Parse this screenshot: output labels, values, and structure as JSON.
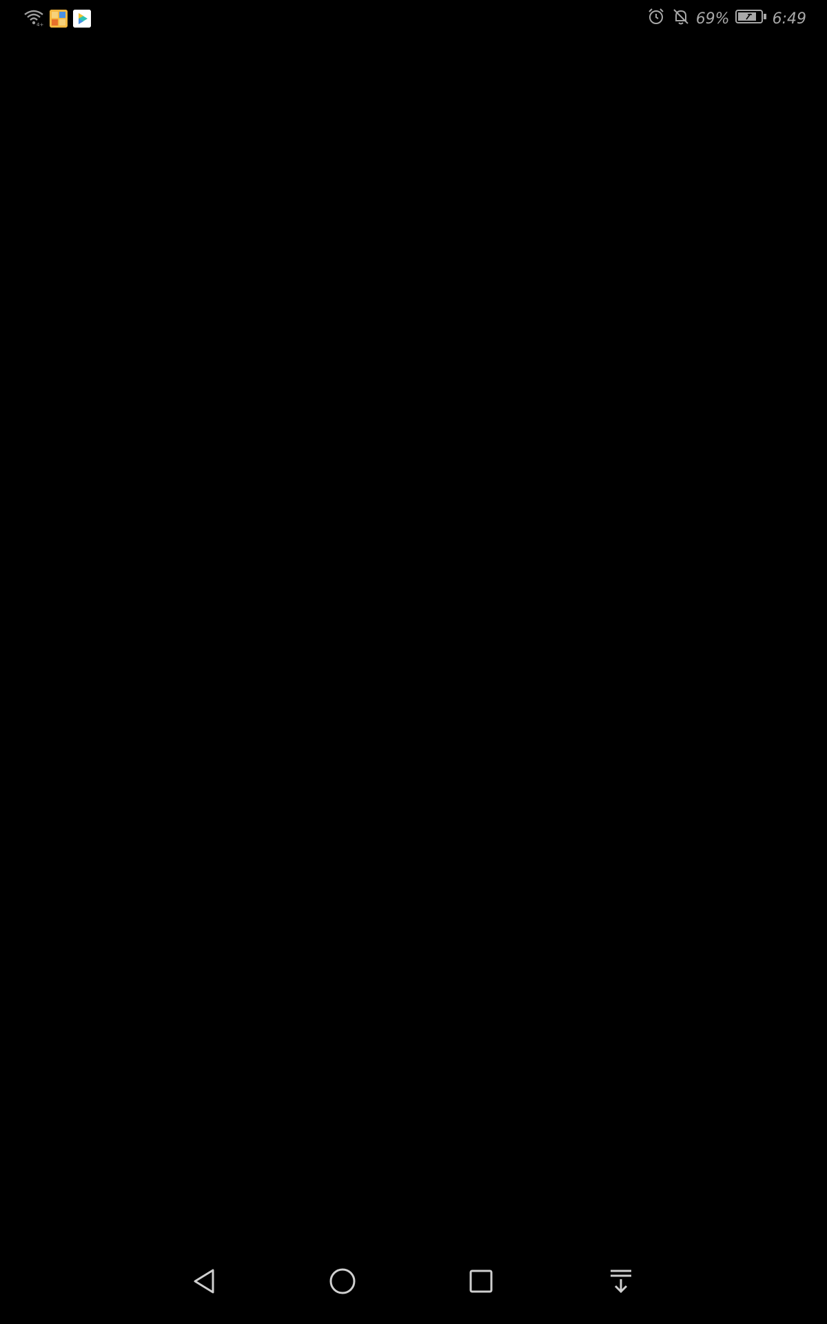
{
  "status_bar": {
    "battery_percent": "69%",
    "time": "6:49",
    "left_icons": [
      "wifi-icon",
      "gallery-app-icon",
      "video-app-icon"
    ],
    "right_icons": [
      "alarm-icon",
      "bell-muted-icon",
      "battery-icon"
    ]
  },
  "colors": {
    "background": "#000000",
    "status_text": "#a8a8a8",
    "nav_icon": "#cfcfcf"
  },
  "navigation_bar": {
    "buttons": [
      "back-icon",
      "home-icon",
      "recent-apps-icon",
      "notification-pulldown-icon"
    ]
  }
}
